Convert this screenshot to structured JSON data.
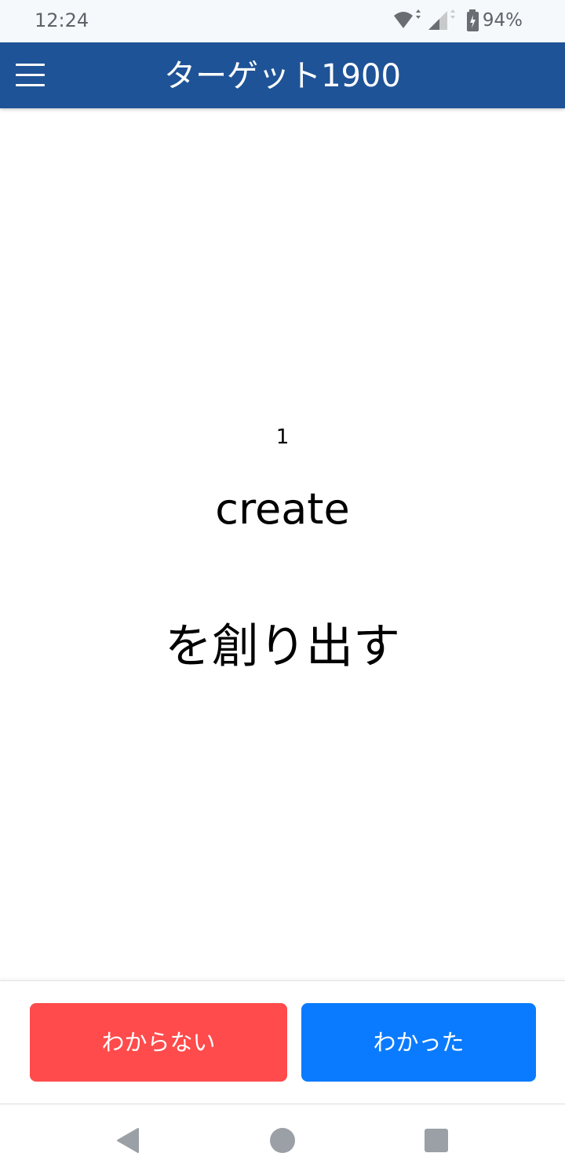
{
  "status_bar": {
    "time": "12:24",
    "battery": "94%",
    "icons": [
      "wifi-icon",
      "cellular-signal-icon",
      "battery-charging-icon"
    ]
  },
  "app_bar": {
    "title": "ターゲット1900",
    "menu_icon": "hamburger-menu-icon",
    "background_color": "#1f5397"
  },
  "card": {
    "number": "1",
    "word": "create",
    "meaning": "を創り出す"
  },
  "actions": {
    "unknown_label": "わからない",
    "unknown_color": "#ff4b4b",
    "known_label": "わかった",
    "known_color": "#0a7bff"
  },
  "nav_bar": {
    "icons": [
      "back-icon",
      "home-icon",
      "recents-icon"
    ]
  }
}
